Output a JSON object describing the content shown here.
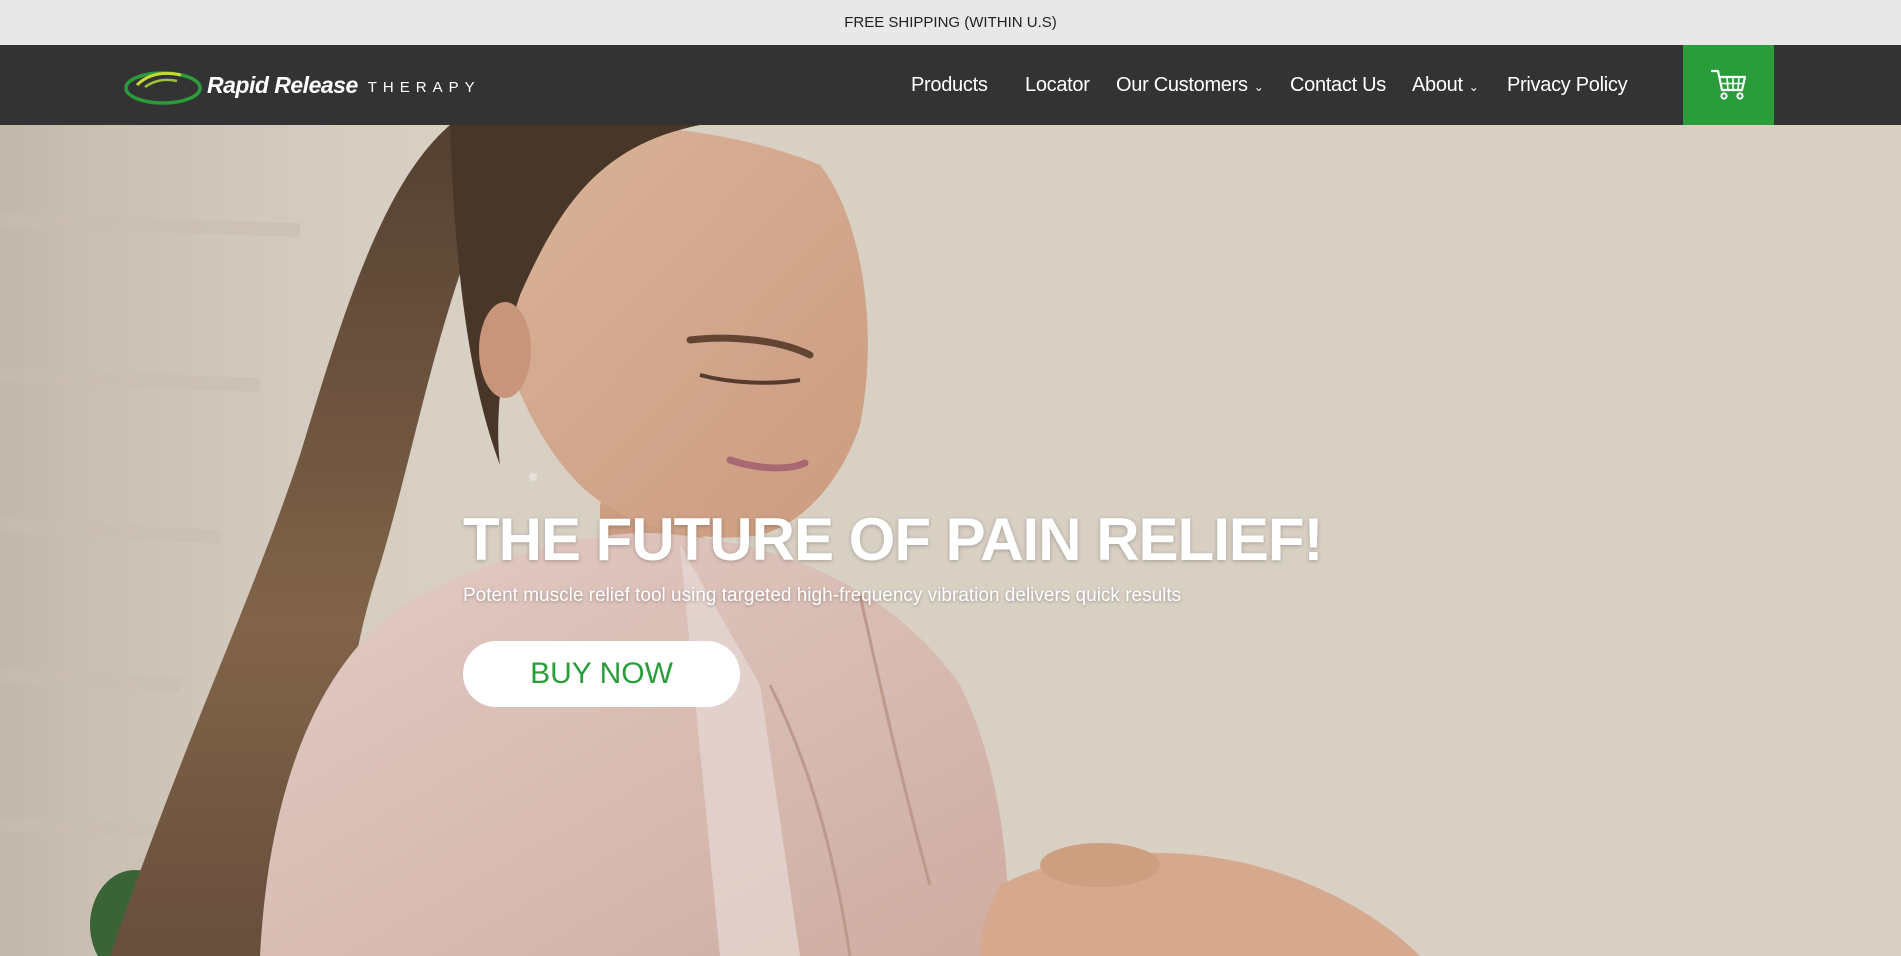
{
  "announcement": {
    "text": "FREE SHIPPING (WITHIN U.S)"
  },
  "header": {
    "logo": {
      "wordmark": "Rapid Release",
      "subtext": "THERAPY"
    },
    "nav": {
      "products": "Products",
      "locator": "Locator",
      "customers": "Our Customers",
      "contact": "Contact Us",
      "about": "About",
      "privacy": "Privacy Policy"
    },
    "cart_icon": "shopping-cart-icon"
  },
  "hero": {
    "title": "THE FUTURE OF PAIN RELIEF!",
    "subtitle": "Potent muscle relief tool using targeted high-frequency vibration delivers quick results",
    "cta_label": "BUY NOW"
  },
  "colors": {
    "brand_green": "#2a9d3a",
    "nav_background": "#333333",
    "announcement_background": "#e8e8e8"
  }
}
